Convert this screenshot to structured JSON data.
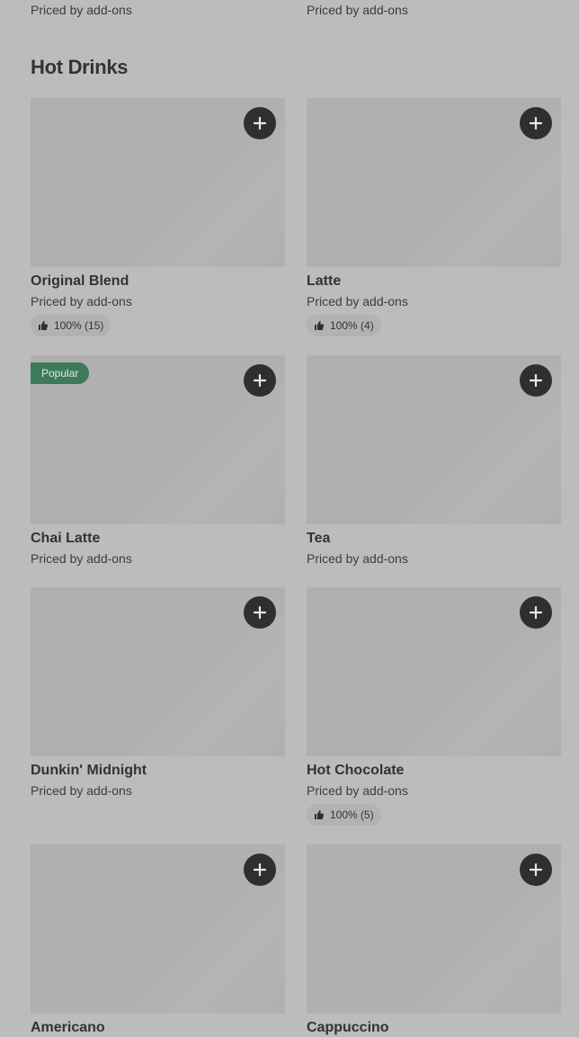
{
  "top_row": {
    "left_price": "Priced by add-ons",
    "right_price": "Priced by add-ons"
  },
  "section": {
    "title": "Hot Drinks"
  },
  "items": [
    {
      "name": "Original Blend",
      "price": "Priced by add-ons",
      "rating": "100% (15)"
    },
    {
      "name": "Latte",
      "price": "Priced by add-ons",
      "rating": "100% (4)"
    },
    {
      "name": "Chai Latte",
      "price": "Priced by add-ons",
      "badge": "Popular"
    },
    {
      "name": "Tea",
      "price": "Priced by add-ons"
    },
    {
      "name": "Dunkin' Midnight",
      "price": "Priced by add-ons"
    },
    {
      "name": "Hot Chocolate",
      "price": "Priced by add-ons",
      "rating": "100% (5)"
    },
    {
      "name": "Americano"
    },
    {
      "name": "Cappuccino"
    }
  ],
  "icons": {
    "add": "plus-icon",
    "rating": "thumbs-up-icon"
  },
  "colors": {
    "background": "#bcbcbc",
    "add_button": "#2f2f2f",
    "badge": "#3d7a5c",
    "image_placeholder": "#b0b0b0"
  }
}
